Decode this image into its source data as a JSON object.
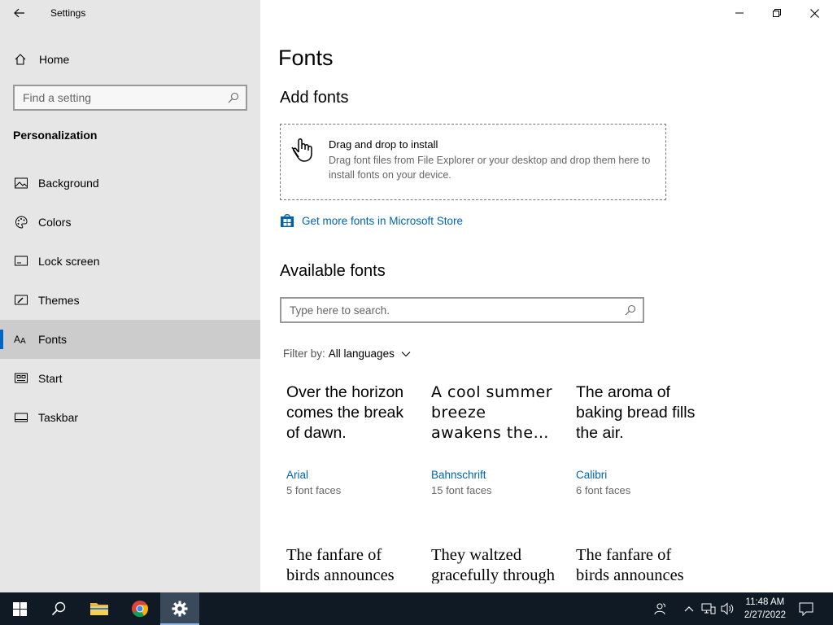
{
  "window": {
    "title": "Settings"
  },
  "sidebar": {
    "home_label": "Home",
    "search_placeholder": "Find a setting",
    "section_title": "Personalization",
    "items": [
      {
        "label": "Background",
        "icon": "picture-icon"
      },
      {
        "label": "Colors",
        "icon": "palette-icon"
      },
      {
        "label": "Lock screen",
        "icon": "lock-screen-icon"
      },
      {
        "label": "Themes",
        "icon": "brush-icon"
      },
      {
        "label": "Fonts",
        "icon": "font-icon",
        "selected": true
      },
      {
        "label": "Start",
        "icon": "start-tiles-icon"
      },
      {
        "label": "Taskbar",
        "icon": "taskbar-icon"
      }
    ]
  },
  "main": {
    "title": "Fonts",
    "add_fonts": {
      "heading": "Add fonts",
      "drop_title": "Drag and drop to install",
      "drop_desc": "Drag font files from File Explorer or your desktop and drop them here to install fonts on your device.",
      "store_link": "Get more fonts in Microsoft Store"
    },
    "available_fonts": {
      "heading": "Available fonts",
      "search_placeholder": "Type here to search.",
      "filter_label": "Filter by:",
      "filter_value": "All languages",
      "cards": [
        {
          "sample": "Over the horizon comes the break of dawn.",
          "name": "Arial",
          "faces": "5 font faces"
        },
        {
          "sample": "A cool summer breeze awakens the…",
          "name": "Bahnschrift",
          "faces": "15 font faces"
        },
        {
          "sample": "The aroma of baking bread fills the air.",
          "name": "Calibri",
          "faces": "6 font faces"
        },
        {
          "sample": "The fanfare of birds announces the morning"
        },
        {
          "sample": "They waltzed gracefully through the air"
        },
        {
          "sample": "The fanfare of birds announces the morning"
        }
      ]
    }
  },
  "taskbar": {
    "time": "11:48 AM",
    "date": "2/27/2022"
  },
  "colors": {
    "sidebar_bg": "#e6e6e6",
    "selected_bg": "#cccccc",
    "accent": "#0067c0",
    "link": "#0063b1",
    "taskbar_bg": "#101a24"
  }
}
